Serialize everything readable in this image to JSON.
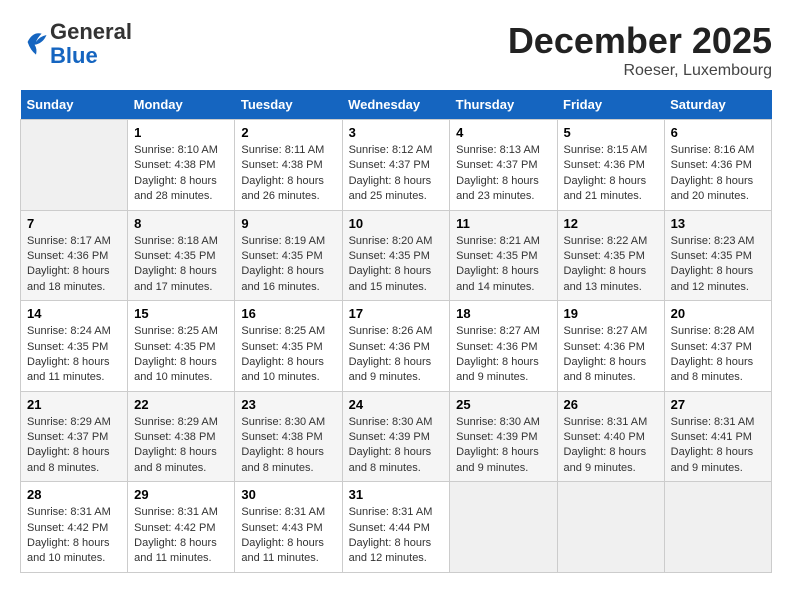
{
  "logo": {
    "general": "General",
    "blue": "Blue"
  },
  "title": "December 2025",
  "subtitle": "Roeser, Luxembourg",
  "days_of_week": [
    "Sunday",
    "Monday",
    "Tuesday",
    "Wednesday",
    "Thursday",
    "Friday",
    "Saturday"
  ],
  "weeks": [
    [
      {
        "num": "",
        "sunrise": "",
        "sunset": "",
        "daylight": ""
      },
      {
        "num": "1",
        "sunrise": "Sunrise: 8:10 AM",
        "sunset": "Sunset: 4:38 PM",
        "daylight": "Daylight: 8 hours and 28 minutes."
      },
      {
        "num": "2",
        "sunrise": "Sunrise: 8:11 AM",
        "sunset": "Sunset: 4:38 PM",
        "daylight": "Daylight: 8 hours and 26 minutes."
      },
      {
        "num": "3",
        "sunrise": "Sunrise: 8:12 AM",
        "sunset": "Sunset: 4:37 PM",
        "daylight": "Daylight: 8 hours and 25 minutes."
      },
      {
        "num": "4",
        "sunrise": "Sunrise: 8:13 AM",
        "sunset": "Sunset: 4:37 PM",
        "daylight": "Daylight: 8 hours and 23 minutes."
      },
      {
        "num": "5",
        "sunrise": "Sunrise: 8:15 AM",
        "sunset": "Sunset: 4:36 PM",
        "daylight": "Daylight: 8 hours and 21 minutes."
      },
      {
        "num": "6",
        "sunrise": "Sunrise: 8:16 AM",
        "sunset": "Sunset: 4:36 PM",
        "daylight": "Daylight: 8 hours and 20 minutes."
      }
    ],
    [
      {
        "num": "7",
        "sunrise": "Sunrise: 8:17 AM",
        "sunset": "Sunset: 4:36 PM",
        "daylight": "Daylight: 8 hours and 18 minutes."
      },
      {
        "num": "8",
        "sunrise": "Sunrise: 8:18 AM",
        "sunset": "Sunset: 4:35 PM",
        "daylight": "Daylight: 8 hours and 17 minutes."
      },
      {
        "num": "9",
        "sunrise": "Sunrise: 8:19 AM",
        "sunset": "Sunset: 4:35 PM",
        "daylight": "Daylight: 8 hours and 16 minutes."
      },
      {
        "num": "10",
        "sunrise": "Sunrise: 8:20 AM",
        "sunset": "Sunset: 4:35 PM",
        "daylight": "Daylight: 8 hours and 15 minutes."
      },
      {
        "num": "11",
        "sunrise": "Sunrise: 8:21 AM",
        "sunset": "Sunset: 4:35 PM",
        "daylight": "Daylight: 8 hours and 14 minutes."
      },
      {
        "num": "12",
        "sunrise": "Sunrise: 8:22 AM",
        "sunset": "Sunset: 4:35 PM",
        "daylight": "Daylight: 8 hours and 13 minutes."
      },
      {
        "num": "13",
        "sunrise": "Sunrise: 8:23 AM",
        "sunset": "Sunset: 4:35 PM",
        "daylight": "Daylight: 8 hours and 12 minutes."
      }
    ],
    [
      {
        "num": "14",
        "sunrise": "Sunrise: 8:24 AM",
        "sunset": "Sunset: 4:35 PM",
        "daylight": "Daylight: 8 hours and 11 minutes."
      },
      {
        "num": "15",
        "sunrise": "Sunrise: 8:25 AM",
        "sunset": "Sunset: 4:35 PM",
        "daylight": "Daylight: 8 hours and 10 minutes."
      },
      {
        "num": "16",
        "sunrise": "Sunrise: 8:25 AM",
        "sunset": "Sunset: 4:35 PM",
        "daylight": "Daylight: 8 hours and 10 minutes."
      },
      {
        "num": "17",
        "sunrise": "Sunrise: 8:26 AM",
        "sunset": "Sunset: 4:36 PM",
        "daylight": "Daylight: 8 hours and 9 minutes."
      },
      {
        "num": "18",
        "sunrise": "Sunrise: 8:27 AM",
        "sunset": "Sunset: 4:36 PM",
        "daylight": "Daylight: 8 hours and 9 minutes."
      },
      {
        "num": "19",
        "sunrise": "Sunrise: 8:27 AM",
        "sunset": "Sunset: 4:36 PM",
        "daylight": "Daylight: 8 hours and 8 minutes."
      },
      {
        "num": "20",
        "sunrise": "Sunrise: 8:28 AM",
        "sunset": "Sunset: 4:37 PM",
        "daylight": "Daylight: 8 hours and 8 minutes."
      }
    ],
    [
      {
        "num": "21",
        "sunrise": "Sunrise: 8:29 AM",
        "sunset": "Sunset: 4:37 PM",
        "daylight": "Daylight: 8 hours and 8 minutes."
      },
      {
        "num": "22",
        "sunrise": "Sunrise: 8:29 AM",
        "sunset": "Sunset: 4:38 PM",
        "daylight": "Daylight: 8 hours and 8 minutes."
      },
      {
        "num": "23",
        "sunrise": "Sunrise: 8:30 AM",
        "sunset": "Sunset: 4:38 PM",
        "daylight": "Daylight: 8 hours and 8 minutes."
      },
      {
        "num": "24",
        "sunrise": "Sunrise: 8:30 AM",
        "sunset": "Sunset: 4:39 PM",
        "daylight": "Daylight: 8 hours and 8 minutes."
      },
      {
        "num": "25",
        "sunrise": "Sunrise: 8:30 AM",
        "sunset": "Sunset: 4:39 PM",
        "daylight": "Daylight: 8 hours and 9 minutes."
      },
      {
        "num": "26",
        "sunrise": "Sunrise: 8:31 AM",
        "sunset": "Sunset: 4:40 PM",
        "daylight": "Daylight: 8 hours and 9 minutes."
      },
      {
        "num": "27",
        "sunrise": "Sunrise: 8:31 AM",
        "sunset": "Sunset: 4:41 PM",
        "daylight": "Daylight: 8 hours and 9 minutes."
      }
    ],
    [
      {
        "num": "28",
        "sunrise": "Sunrise: 8:31 AM",
        "sunset": "Sunset: 4:42 PM",
        "daylight": "Daylight: 8 hours and 10 minutes."
      },
      {
        "num": "29",
        "sunrise": "Sunrise: 8:31 AM",
        "sunset": "Sunset: 4:42 PM",
        "daylight": "Daylight: 8 hours and 11 minutes."
      },
      {
        "num": "30",
        "sunrise": "Sunrise: 8:31 AM",
        "sunset": "Sunset: 4:43 PM",
        "daylight": "Daylight: 8 hours and 11 minutes."
      },
      {
        "num": "31",
        "sunrise": "Sunrise: 8:31 AM",
        "sunset": "Sunset: 4:44 PM",
        "daylight": "Daylight: 8 hours and 12 minutes."
      },
      {
        "num": "",
        "sunrise": "",
        "sunset": "",
        "daylight": ""
      },
      {
        "num": "",
        "sunrise": "",
        "sunset": "",
        "daylight": ""
      },
      {
        "num": "",
        "sunrise": "",
        "sunset": "",
        "daylight": ""
      }
    ]
  ]
}
